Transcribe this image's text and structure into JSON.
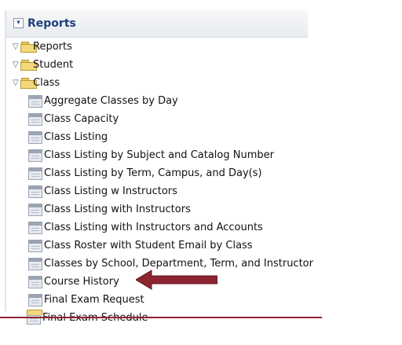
{
  "panel": {
    "title": "Reports"
  },
  "tree": {
    "folders": [
      {
        "label": "Reports"
      },
      {
        "label": "Student"
      },
      {
        "label": "Class"
      }
    ],
    "class_reports": [
      "Aggregate Classes by Day",
      "Class Capacity",
      "Class Listing",
      "Class Listing by Subject and Catalog Number",
      "Class Listing by Term, Campus, and Day(s)",
      "Class Listing w Instructors",
      "Class Listing with Instructors",
      "Class Listing with Instructors and Accounts",
      "Class Roster with Student Email by Class",
      "Classes by School, Department, Term, and Instructor",
      "Course History",
      "Final Exam Request",
      "Final Exam Schedule"
    ]
  },
  "colors": {
    "arrow": "#8e2431",
    "header_text": "#1f3f7a",
    "folder": "#f3d77a"
  }
}
